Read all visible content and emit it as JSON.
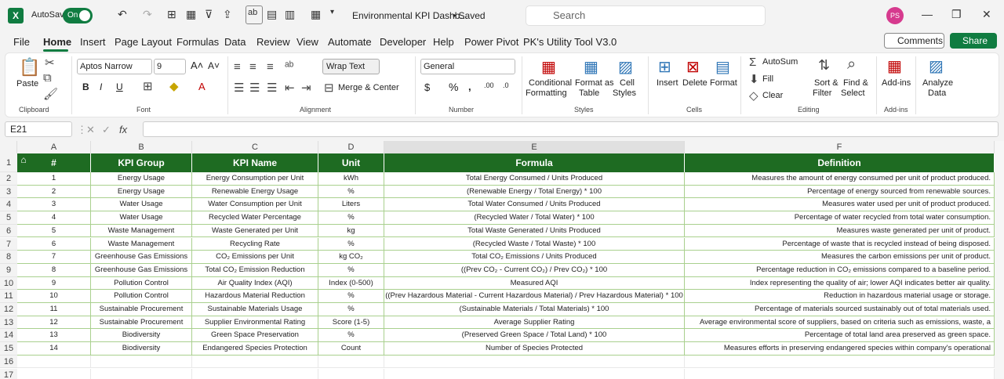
{
  "app": {
    "autosave_label": "AutoSave",
    "autosave_state": "On",
    "doc_title": "Environmental KPI Dashb...",
    "saved": "• Saved",
    "search_placeholder": "Search",
    "avatar": "PS"
  },
  "menu": [
    "File",
    "Home",
    "Insert",
    "Page Layout",
    "Formulas",
    "Data",
    "Review",
    "View",
    "Automate",
    "Developer",
    "Help",
    "Power Pivot",
    "PK's Utility Tool V3.0"
  ],
  "actions": {
    "comments": "Comments",
    "share": "Share"
  },
  "ribbon": {
    "paste": "Paste",
    "clipboard": "Clipboard",
    "font_name": "Aptos Narrow",
    "font_size": "9",
    "font_group": "Font",
    "wrap_text": "Wrap Text",
    "merge_center": "Merge & Center",
    "alignment": "Alignment",
    "number_format": "General",
    "number": "Number",
    "conditional": "Conditional",
    "formatting": "Formatting",
    "format_as": "Format as",
    "table": "Table",
    "cell": "Cell",
    "styles_btn": "Styles",
    "styles": "Styles",
    "insert": "Insert",
    "delete": "Delete",
    "format": "Format",
    "cells": "Cells",
    "autosum": "AutoSum",
    "fill": "Fill",
    "clear": "Clear",
    "sort": "Sort &",
    "filter": "Filter",
    "find": "Find &",
    "select": "Select",
    "editing": "Editing",
    "addins_btn": "Add-ins",
    "addins": "Add-ins",
    "analyze": "Analyze",
    "analyze_data": "Data"
  },
  "formula_bar": {
    "name_box": "E21",
    "fx": "fx"
  },
  "columns": [
    "A",
    "B",
    "C",
    "D",
    "E",
    "F"
  ],
  "headers": [
    "#",
    "KPI Group",
    "KPI Name",
    "Unit",
    "Formula",
    "Definition"
  ],
  "rows": [
    [
      "1",
      "Energy Usage",
      "Energy Consumption per Unit",
      "kWh",
      "Total Energy Consumed / Units Produced",
      "Measures the amount of energy consumed per unit of product produced."
    ],
    [
      "2",
      "Energy Usage",
      "Renewable Energy Usage",
      "%",
      "(Renewable Energy / Total Energy) * 100",
      "Percentage of energy sourced from renewable sources."
    ],
    [
      "3",
      "Water Usage",
      "Water Consumption per Unit",
      "Liters",
      "Total Water Consumed / Units Produced",
      "Measures water used per unit of product produced."
    ],
    [
      "4",
      "Water Usage",
      "Recycled Water Percentage",
      "%",
      "(Recycled Water / Total Water) * 100",
      "Percentage of water recycled from total water consumption."
    ],
    [
      "5",
      "Waste Management",
      "Waste Generated per Unit",
      "kg",
      "Total Waste Generated / Units Produced",
      "Measures waste generated per unit of product."
    ],
    [
      "6",
      "Waste Management",
      "Recycling Rate",
      "%",
      "(Recycled Waste / Total Waste) * 100",
      "Percentage of waste that is recycled instead of being disposed."
    ],
    [
      "7",
      "Greenhouse Gas Emissions",
      "CO₂ Emissions per Unit",
      "kg CO₂",
      "Total CO₂ Emissions / Units Produced",
      "Measures the carbon emissions per unit of product."
    ],
    [
      "8",
      "Greenhouse Gas Emissions",
      "Total CO₂ Emission Reduction",
      "%",
      "((Prev CO₂ - Current CO₂) / Prev CO₂) * 100",
      "Percentage reduction in CO₂ emissions compared to a baseline period."
    ],
    [
      "9",
      "Pollution Control",
      "Air Quality Index (AQI)",
      "Index (0-500)",
      "Measured AQI",
      "Index representing the quality of air; lower AQI indicates better air quality."
    ],
    [
      "10",
      "Pollution Control",
      "Hazardous Material Reduction",
      "%",
      "((Prev Hazardous Material - Current Hazardous Material) / Prev Hazardous Material) * 100",
      "Reduction in hazardous material usage or storage."
    ],
    [
      "11",
      "Sustainable Procurement",
      "Sustainable Materials Usage",
      "%",
      "(Sustainable Materials / Total Materials) * 100",
      "Percentage of materials sourced sustainably out of total materials used."
    ],
    [
      "12",
      "Sustainable Procurement",
      "Supplier Environmental Rating",
      "Score (1-5)",
      "Average Supplier Rating",
      "Average environmental score of suppliers, based on criteria such as emissions, waste, a"
    ],
    [
      "13",
      "Biodiversity",
      "Green Space Preservation",
      "%",
      "(Preserved Green Space / Total Land) * 100",
      "Percentage of total land area preserved as green space."
    ],
    [
      "14",
      "Biodiversity",
      "Endangered Species Protection",
      "Count",
      "Number of Species Protected",
      "Measures efforts in preserving endangered species within company's operational"
    ]
  ],
  "row_numbers": [
    "1",
    "2",
    "3",
    "4",
    "5",
    "6",
    "7",
    "8",
    "9",
    "10",
    "11",
    "12",
    "13",
    "14",
    "15",
    "16",
    "17"
  ]
}
